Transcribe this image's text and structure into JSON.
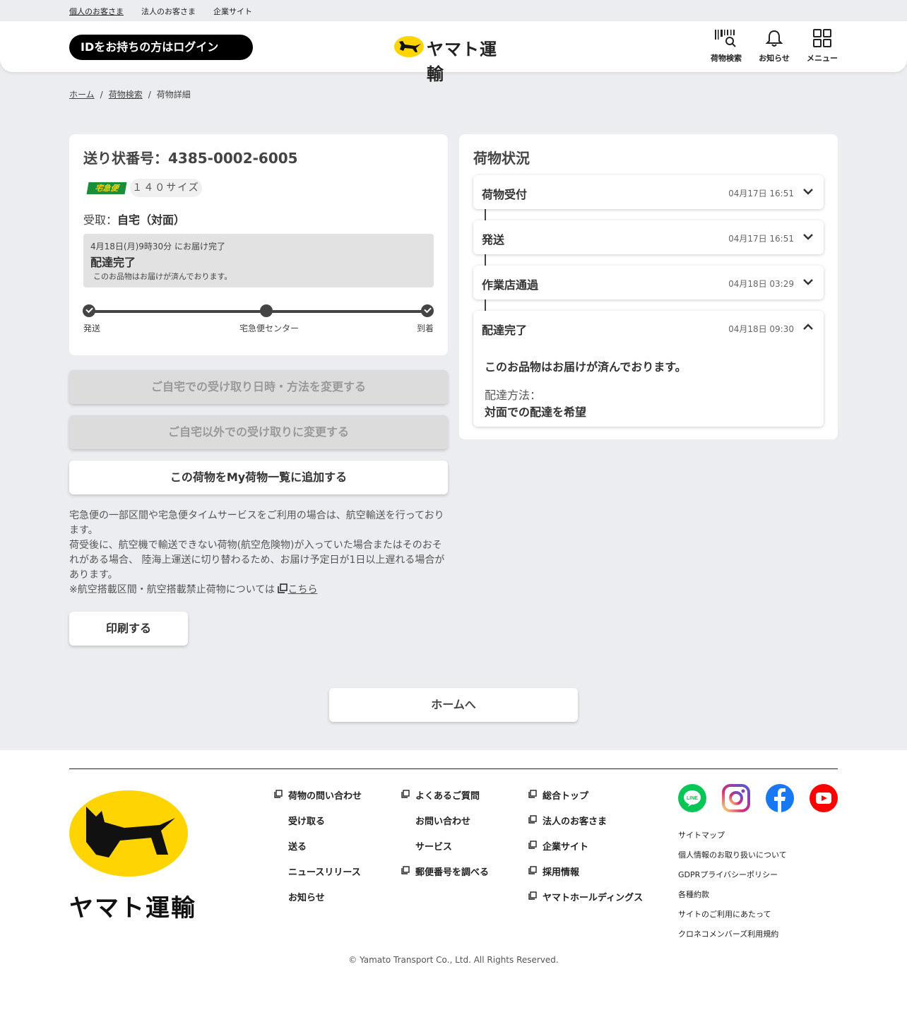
{
  "topbar": {
    "personal": "個人のお客さま",
    "corporate": "法人のお客さま",
    "company": "企業サイト"
  },
  "header": {
    "login_label": "IDをお持ちの方はログイン",
    "logo_text": "ヤマト運輸",
    "nav": {
      "search": "荷物検索",
      "notice": "お知らせ",
      "menu": "メニュー"
    }
  },
  "breadcrumb": {
    "home": "ホーム",
    "search": "荷物検索",
    "current": "荷物詳細",
    "separator": "/"
  },
  "shipment": {
    "tracking_title": "送り状番号：4385-0002-6005",
    "service_badge": "宅急便",
    "size": "１４０サイズ",
    "receipt_label": "受取：",
    "receipt_value": "自宅（対面）",
    "status_date": "4月18日(月)9時30分 にお届け完了",
    "status_main": "配達完了",
    "status_note": "このお品物はお届けが済んでおります。",
    "progress": {
      "start": "発送",
      "middle": "宅急便センター",
      "end": "到着"
    }
  },
  "actions": {
    "change_home": "ご自宅での受け取り日時・方法を変更する",
    "change_other": "ご自宅以外での受け取りに変更する",
    "add_my_list": "この荷物をMy荷物一覧に追加する",
    "print": "印刷する",
    "home": "ホームへ"
  },
  "note": {
    "line1": "宅急便の一部区間や宅急便タイムサービスをご利用の場合は、航空輸送を行っております。",
    "line2": "荷受後に、航空機で輸送できない荷物(航空危険物)が入っていた場合またはそのおそれがある場合、 陸海上運送に切り替わるため、お届け予定日が1日以上遅れる場合があります。",
    "line3_prefix": "※航空搭載区間・航空搭載禁止荷物については",
    "line3_link": "こちら"
  },
  "status_panel": {
    "title": "荷物状況",
    "items": [
      {
        "title": "荷物受付",
        "date": "04月17日 16:51"
      },
      {
        "title": "発送",
        "date": "04月17日 16:51"
      },
      {
        "title": "作業店通過",
        "date": "04月18日 03:29"
      },
      {
        "title": "配達完了",
        "date": "04月18日 09:30",
        "detail": "このお品物はお届けが済んでおります。",
        "method_label": "配達方法：",
        "method_value": "対面での配達を希望"
      }
    ]
  },
  "footer": {
    "logo_text": "ヤマト運輸",
    "col1": [
      "荷物の問い合わせ",
      "受け取る",
      "送る",
      "ニュースリリース",
      "お知らせ"
    ],
    "col2": [
      "よくあるご質問",
      "お問い合わせ",
      "サービス",
      "郵便番号を調べる"
    ],
    "col3": [
      "総合トップ",
      "法人のお客さま",
      "企業サイト",
      "採用情報",
      "ヤマトホールディングス"
    ],
    "social": [
      "LINE",
      "Instagram",
      "Facebook",
      "YouTube"
    ],
    "links": [
      "サイトマップ",
      "個人情報のお取り扱いについて",
      "GDPRプライバシーポリシー",
      "各種約款",
      "サイトのご利用にあたって",
      "クロネコメンバーズ利用規約"
    ],
    "copyright": "© Yamato Transport Co., Ltd. All Rights Reserved."
  },
  "colors": {
    "brand_yellow": "#ffd400",
    "accent_green": "#1a8f3a",
    "line": "#06c755",
    "facebook": "#1877f2",
    "youtube": "#ff0000"
  }
}
